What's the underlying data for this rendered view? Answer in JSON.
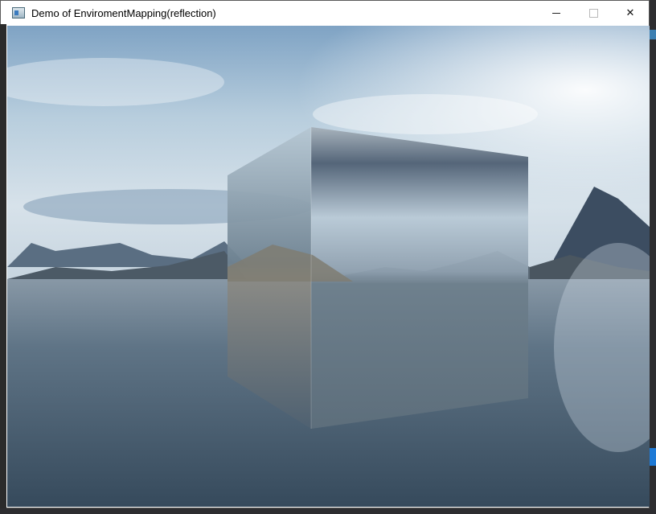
{
  "window": {
    "title": "Demo of EnviromentMapping(reflection)",
    "icon": "app-window-icon"
  },
  "controls": {
    "minimize_icon": "minimize-icon",
    "maximize_icon": "maximize-icon",
    "close_glyph": "✕"
  },
  "colors": {
    "sky_top": "#5b86b0",
    "sky_bright": "#eef3f7",
    "water": "#4b6275",
    "cube_face": "#8fa3b4"
  }
}
